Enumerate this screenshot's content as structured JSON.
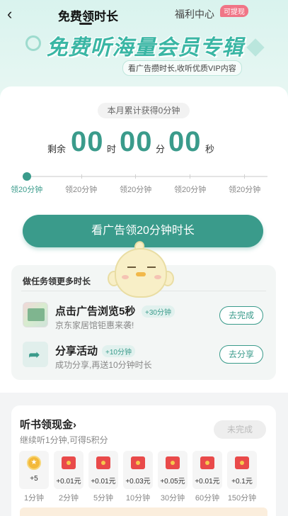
{
  "header": {
    "back_icon": "chevron-left-icon",
    "tab_free": "免费领时长",
    "tab_welfare": "福利中心",
    "badge_withdraw": "可提现"
  },
  "banner": {
    "title": "免费听海量会员专辑",
    "subtitle": "看广告攒时长,收听优质VIP内容"
  },
  "timer": {
    "month_total": "本月累计获得0分钟",
    "remain_label": "剩余",
    "hours": "00",
    "hour_unit": "时",
    "minutes": "00",
    "minute_unit": "分",
    "seconds": "00",
    "second_unit": "秒"
  },
  "steps": [
    "领20分钟",
    "领20分钟",
    "领20分钟",
    "领20分钟",
    "领20分钟"
  ],
  "progress_completed_steps": 0,
  "watch_button": "看广告领20分钟时长",
  "tasks": {
    "title": "做任务领更多时长",
    "items": [
      {
        "name": "点击广告浏览5秒",
        "bonus": "+30分钟",
        "desc": "京东家居馆钜惠来袭!",
        "button": "去完成",
        "icon": "ad-thumbnail"
      },
      {
        "name": "分享活动",
        "bonus": "+10分钟",
        "desc": "成功分享,再送10分钟时长",
        "button": "去分享",
        "icon": "share-arrow-icon"
      }
    ]
  },
  "cash": {
    "title": "听书领现金",
    "chevron": "›",
    "subtitle": "继续听1分钟,可得5积分",
    "status_button": "未完成",
    "rewards": [
      {
        "value": "+5",
        "time": "1分钟",
        "icon": "coin-icon"
      },
      {
        "value": "+0.01元",
        "time": "2分钟",
        "icon": "red-packet-icon"
      },
      {
        "value": "+0.01元",
        "time": "5分钟",
        "icon": "red-packet-icon"
      },
      {
        "value": "+0.03元",
        "time": "10分钟",
        "icon": "red-packet-icon"
      },
      {
        "value": "+0.05元",
        "time": "30分钟",
        "icon": "red-packet-icon"
      },
      {
        "value": "+0.01元",
        "time": "60分钟",
        "icon": "red-packet-icon"
      },
      {
        "value": "+0.1元",
        "time": "150分钟",
        "icon": "red-packet-icon"
      }
    ]
  },
  "colors": {
    "accent": "#3a9b8b",
    "banner_title": "#3ab6a4",
    "badge": "#f07586",
    "red_packet": "#e94a4a"
  }
}
